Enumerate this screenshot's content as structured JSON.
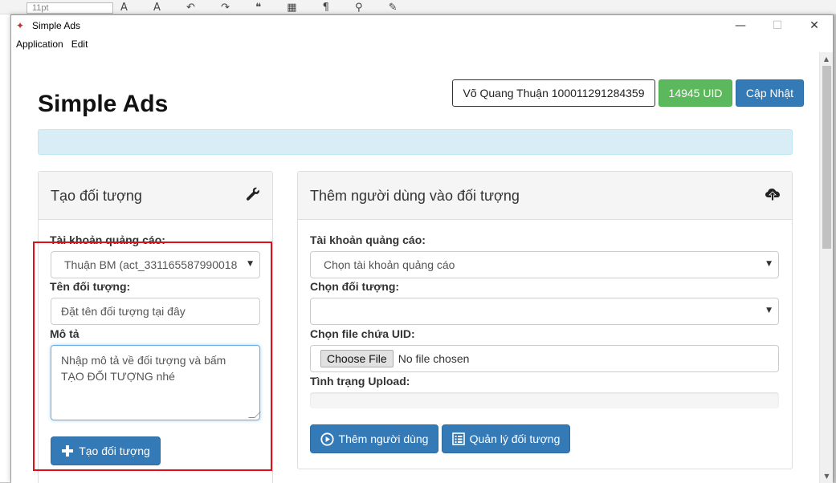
{
  "background": {
    "font_size_field": "11pt"
  },
  "window": {
    "title": "Simple Ads",
    "app_icon": "star-icon",
    "controls": {
      "minimize": "—",
      "maximize": "☐",
      "close": "✕"
    }
  },
  "menubar": {
    "items": [
      "Application",
      "Edit"
    ]
  },
  "header": {
    "title": "Simple Ads",
    "user_label": "Võ Quang Thuận 100011291284359",
    "uid_count_label": "14945 UID",
    "update_label": "Cập Nhật"
  },
  "colors": {
    "primary": "#337ab7",
    "success": "#5cb85c",
    "info_bg": "#d9edf7",
    "highlight_box": "#e0101b"
  },
  "create_panel": {
    "title": "Tạo đối tượng",
    "icon": "wrench-icon",
    "ad_account_label": "Tài khoản quảng cáo:",
    "ad_account_value": "Thuận BM (act_331165587990018",
    "audience_name_label": "Tên đối tượng:",
    "audience_name_placeholder": "Đặt tên đối tượng tại đây",
    "description_label": "Mô tả",
    "description_placeholder_line1": "Nhập mô tả về đối tượng và bấm",
    "description_placeholder_line2": "TẠO ĐỐI TƯỢNG nhé",
    "create_button_label": "Tạo đối tượng",
    "create_button_icon": "plus-icon"
  },
  "add_users_panel": {
    "title": "Thêm người dùng vào đối tượng",
    "icon": "cloud-upload-icon",
    "ad_account_label": "Tài khoản quảng cáo:",
    "ad_account_value": "Chọn tài khoản quảng cáo",
    "audience_label": "Chọn đối tượng:",
    "audience_value": "",
    "file_label": "Chọn file chứa UID:",
    "choose_file_label": "Choose File",
    "no_file_label": "No file chosen",
    "upload_status_label": "Tình trạng Upload:",
    "upload_progress": 0,
    "add_users_button_label": "Thêm người dùng",
    "add_users_button_icon": "play-circle-icon",
    "manage_button_label": "Quản lý đối tượng",
    "manage_button_icon": "list-icon"
  }
}
